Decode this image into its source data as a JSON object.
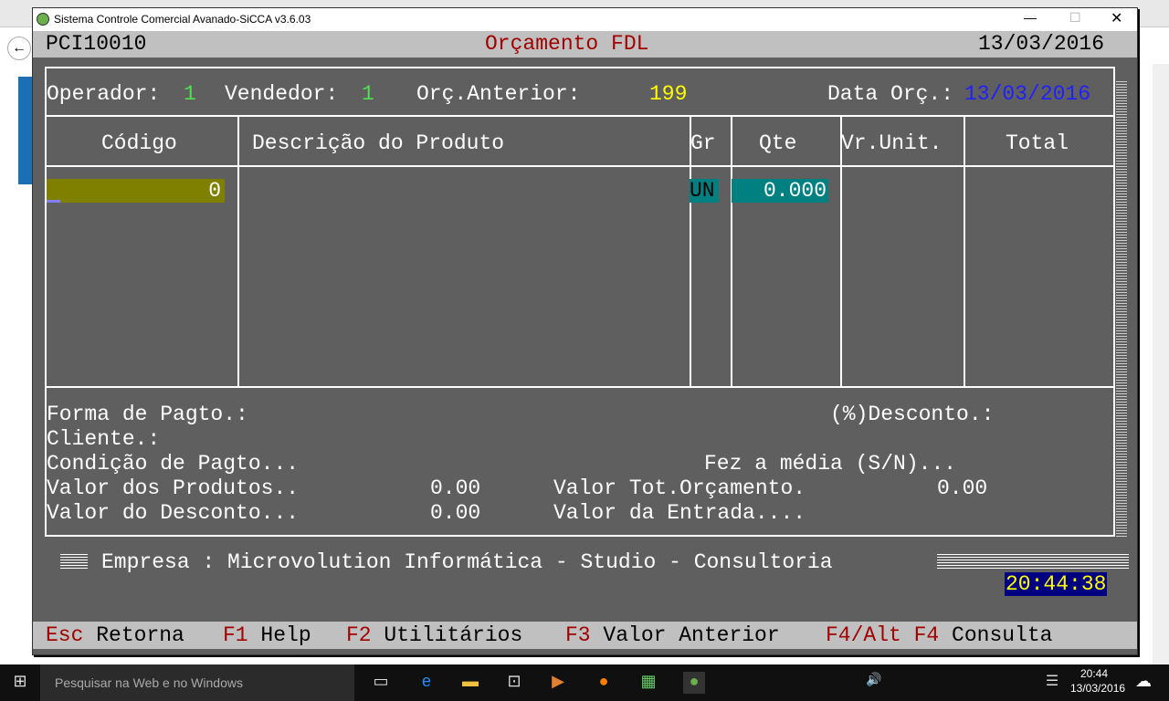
{
  "window": {
    "title": "Sistema Controle Comercial Avanado-SiCCA v3.6.03"
  },
  "header": {
    "code": "PCI10010",
    "title": "Orçamento FDL",
    "date": "13/03/2016"
  },
  "info": {
    "operador_label": "Operador:",
    "operador": "1",
    "vendedor_label": "Vendedor:",
    "vendedor": "1",
    "orc_anterior_label": "Orç.Anterior:",
    "orc_anterior": "199",
    "data_label": "Data Orç.:",
    "data": "13/03/2016"
  },
  "table": {
    "columns": [
      "Código",
      "Descrição do Produto",
      "Gr",
      "Qte",
      "Vr.Unit.",
      "Total"
    ],
    "row": {
      "codigo": "0",
      "gr": "UN",
      "qte": "0.000"
    }
  },
  "summary": {
    "forma": "Forma de Pagto.:",
    "desconto": "(%)Desconto.:",
    "cliente": "Cliente.:",
    "condicao": "Condição de Pagto...",
    "media": "Fez a média (S/N)...",
    "valor_produtos_label": "Valor dos Produtos..",
    "valor_produtos": "0.00",
    "valor_tot_label": "Valor Tot.Orçamento.",
    "valor_tot": "0.00",
    "valor_desconto_label": "Valor do Desconto...",
    "valor_desconto": "0.00",
    "valor_entrada_label": "Valor da Entrada...."
  },
  "empresa": "Empresa : Microvolution Informática - Studio - Consultoria",
  "clock": "20:44:38",
  "footer": [
    {
      "key": "Esc",
      "label": "Retorna"
    },
    {
      "key": "F1",
      "label": "Help"
    },
    {
      "key": "F2",
      "label": "Utilitários"
    },
    {
      "key": "F3",
      "label": "Valor Anterior"
    },
    {
      "key": "F4/Alt F4",
      "label": "Consulta"
    }
  ],
  "taskbar": {
    "search_placeholder": "Pesquisar na Web e no Windows",
    "time": "20:44",
    "date": "13/03/2016"
  }
}
